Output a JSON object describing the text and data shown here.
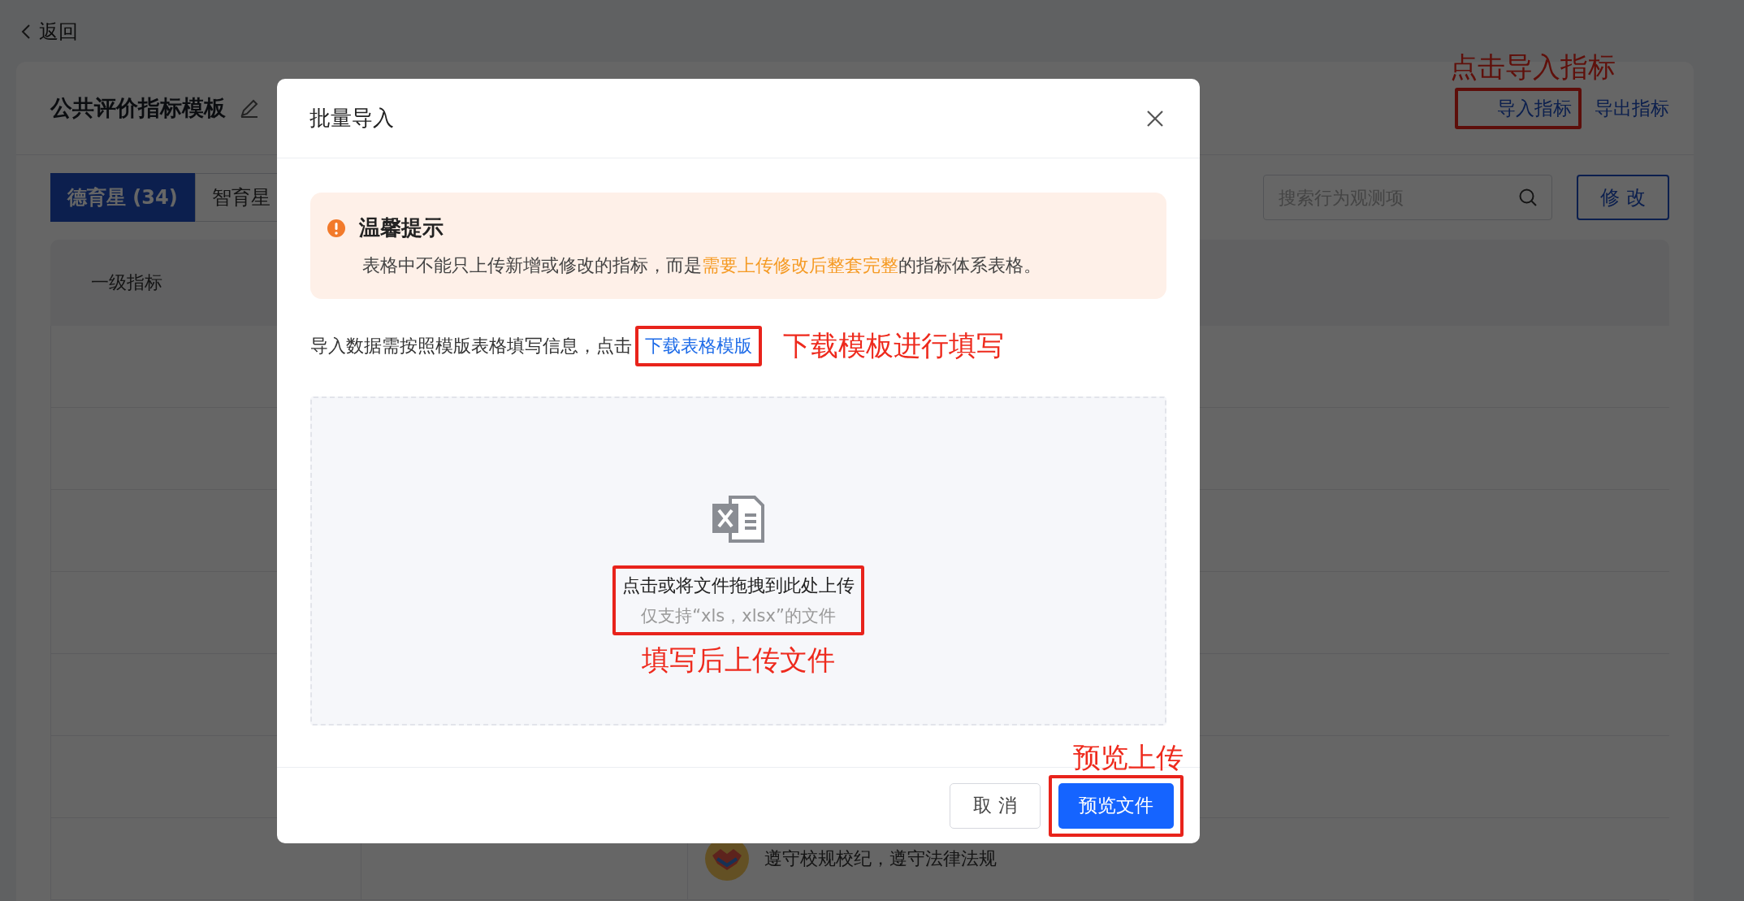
{
  "back_link": {
    "label": "返回"
  },
  "header": {
    "title": "公共评价指标模板",
    "links": [
      {
        "label": "导入指标",
        "highlighted": true,
        "callout": "点击导入指标"
      },
      {
        "label": "导出指标",
        "highlighted": false
      }
    ]
  },
  "tabs": [
    {
      "label": "德育星 (34)",
      "selected": true
    },
    {
      "label": "智育星",
      "selected": false
    }
  ],
  "search": {
    "placeholder": "搜索行为观测项"
  },
  "edit_button": {
    "label": "修 改"
  },
  "table": {
    "columns": [
      "一级指标"
    ],
    "visible_cell": {
      "text": "遵守校规校纪，遵守法律法规"
    }
  },
  "dialog": {
    "title": "批量导入",
    "notice": {
      "title": "温馨提示",
      "text_before": "表格中不能只上传新增或修改的指标，而是",
      "emphasis": "需要上传修改后整套完整",
      "text_after": "的指标体系表格。"
    },
    "instruction": {
      "text": "导入数据需按照模版表格填写信息，点击",
      "link": "下载表格模版",
      "highlighted": true,
      "callout": "下载模板进行填写"
    },
    "dropzone": {
      "prompt": "点击或将文件拖拽到此处上传",
      "hint": "仅支持“xls，xlsx”的文件",
      "highlighted": true,
      "callout": "填写后上传文件"
    },
    "buttons": [
      {
        "label": "取 消",
        "kind": "default",
        "highlighted": false
      },
      {
        "label": "预览文件",
        "kind": "primary",
        "highlighted": true,
        "callout": "预览上传"
      }
    ]
  }
}
